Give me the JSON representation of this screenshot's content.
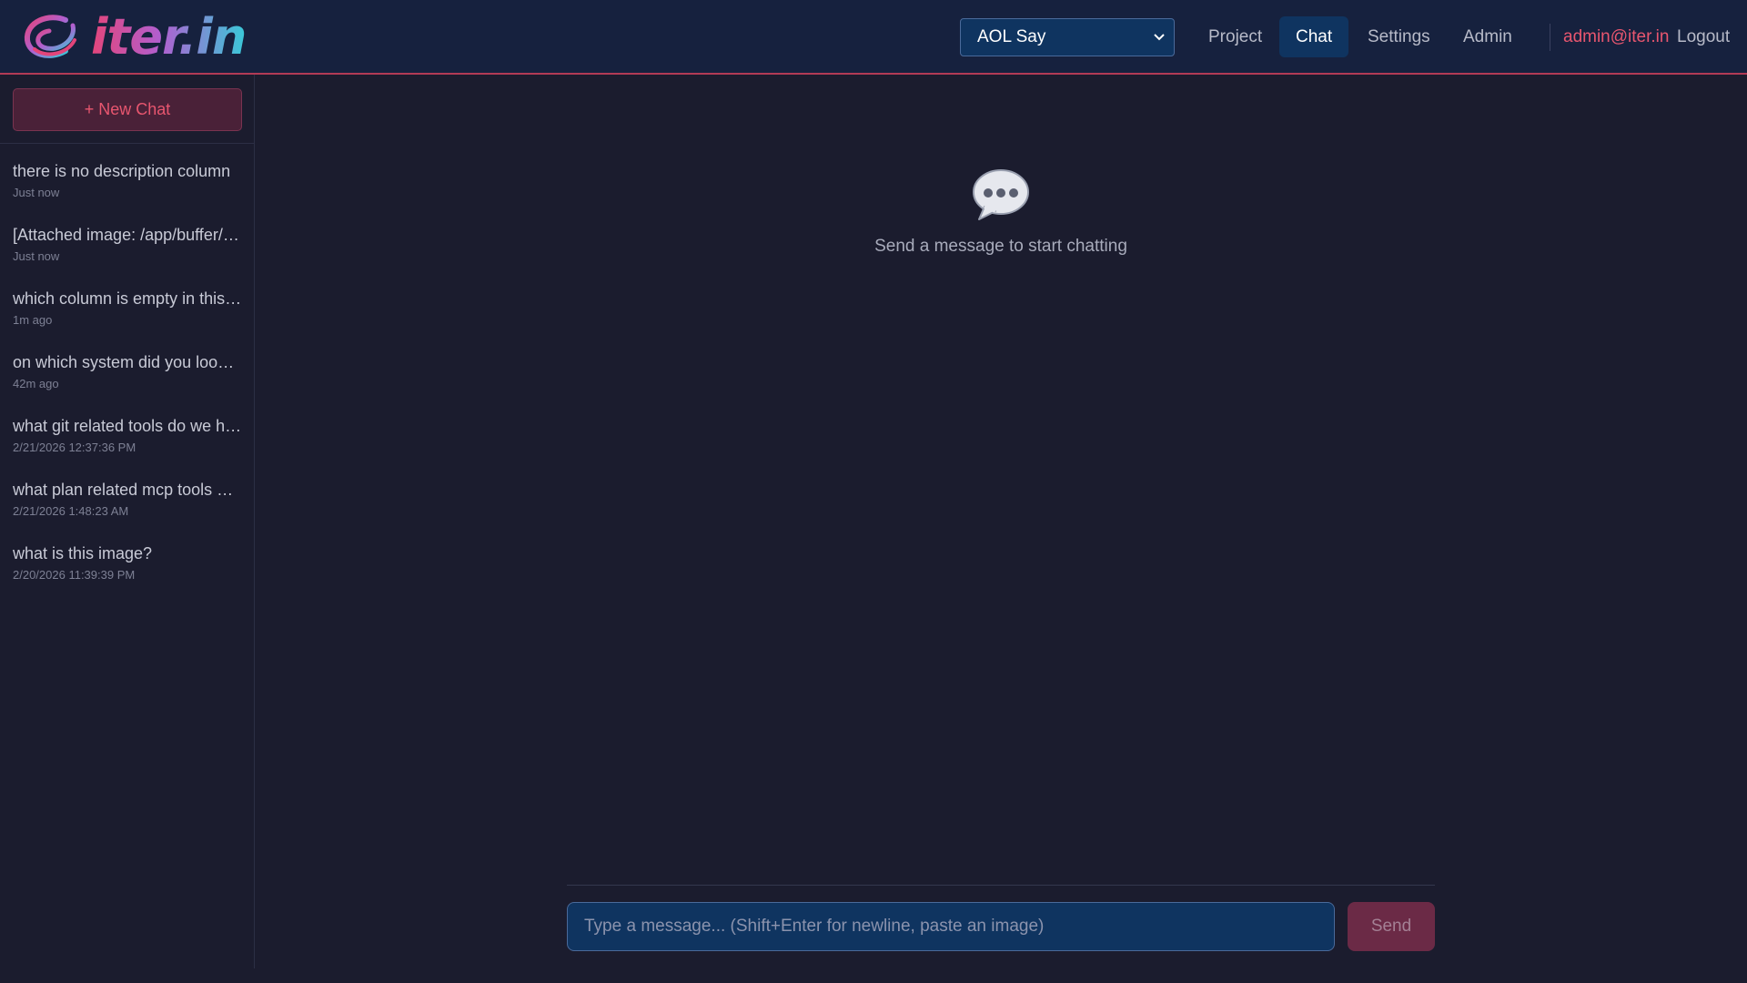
{
  "header": {
    "logo_text": "iter.in",
    "project_select": {
      "value": "AOL Say"
    },
    "nav": {
      "project": "Project",
      "chat": "Chat",
      "settings": "Settings",
      "admin": "Admin"
    },
    "active_nav": "chat",
    "user_email": "admin@iter.in",
    "logout": "Logout"
  },
  "sidebar": {
    "new_chat_label": "+ New Chat",
    "chats": [
      {
        "title": "there is no description column",
        "time": "Just now"
      },
      {
        "title": "[Attached image: /app/buffer/…",
        "time": "Just now"
      },
      {
        "title": "which column is empty in this…",
        "time": "1m ago"
      },
      {
        "title": "on which system did you loo…",
        "time": "42m ago"
      },
      {
        "title": "what git related tools do we h…",
        "time": "2/21/2026 12:37:36 PM"
      },
      {
        "title": "what plan related mcp tools …",
        "time": "2/21/2026 1:48:23 AM"
      },
      {
        "title": "what is this image?",
        "time": "2/20/2026 11:39:39 PM"
      }
    ]
  },
  "main": {
    "empty_state": {
      "icon": "speech-bubble-icon",
      "text": "Send a message to start chatting"
    },
    "composer": {
      "placeholder": "Type a message... (Shift+Enter for newline, paste an image)",
      "send_label": "Send"
    }
  },
  "colors": {
    "background": "#1b1c2e",
    "header_bg": "#16213e",
    "accent": "#e8566f",
    "nav_active_bg": "#0f3460"
  }
}
